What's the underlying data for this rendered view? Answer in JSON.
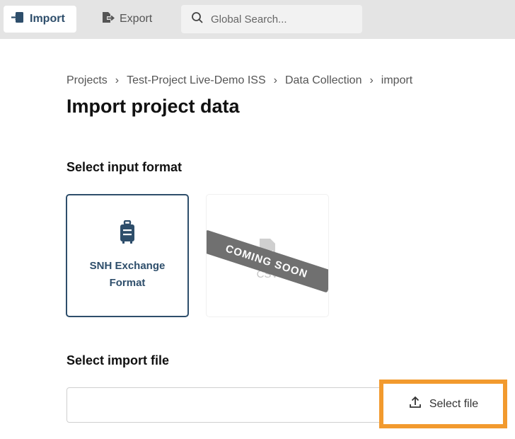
{
  "toolbar": {
    "import_label": "Import",
    "export_label": "Export",
    "search_placeholder": "Global Search..."
  },
  "breadcrumb": [
    "Projects",
    "Test-Project Live-Demo ISS",
    "Data Collection",
    "import"
  ],
  "page_title": "Import project data",
  "input_format": {
    "heading": "Select input format",
    "options": [
      {
        "label": "SNH Exchange Format",
        "icon": "suitcase-icon",
        "selected": true
      },
      {
        "label": "CSV",
        "icon": "csv-file-icon",
        "badge": "COMING SOON",
        "disabled": true
      }
    ]
  },
  "import_file": {
    "heading": "Select import file",
    "button_label": "Select file",
    "value": ""
  },
  "colors": {
    "accent": "#2e4e6b",
    "highlight": "#f29a2e",
    "topbar": "#e4e4e4"
  }
}
